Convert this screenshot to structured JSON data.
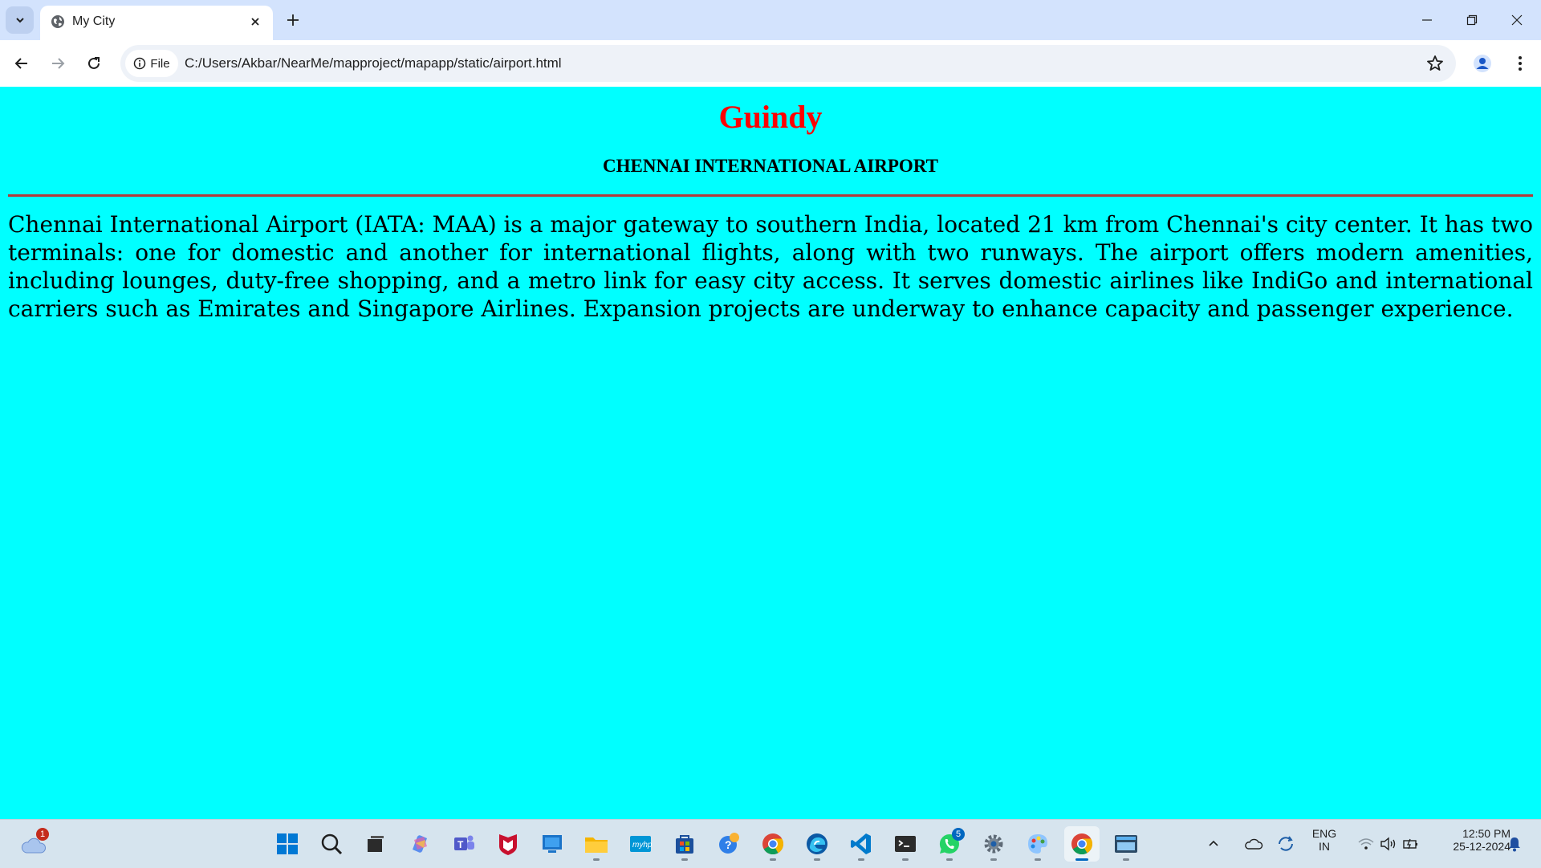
{
  "browser": {
    "tab": {
      "title": "My City"
    },
    "address": {
      "chip": "File",
      "url": "C:/Users/Akbar/NearMe/mapproject/mapapp/static/airport.html"
    }
  },
  "page": {
    "heading": "Guindy",
    "subheading": "CHENNAI INTERNATIONAL AIRPORT",
    "description": "Chennai International Airport (IATA: MAA) is a major gateway to southern India, located 21 km from Chennai's city center. It has two terminals: one for domestic and another for international flights, along with two runways. The airport offers modern amenities, including lounges, duty-free shopping, and a metro link for easy city access. It serves domestic airlines like IndiGo and international carriers such as Emirates and Singapore Airlines. Expansion projects are underway to enhance capacity and passenger experience.",
    "colors": {
      "background": "#00ffff",
      "heading": "#ff0000",
      "rule": "#b23a3a"
    }
  },
  "taskbar": {
    "weather_badge": "1",
    "whatsapp_badge": "5",
    "apps": [
      "start-icon",
      "search-icon",
      "task-view-icon",
      "copilot-icon",
      "teams-icon",
      "mcafee-icon",
      "desktop-app-icon",
      "file-explorer-icon",
      "myhp-icon",
      "store-icon",
      "help-icon",
      "chrome-icon",
      "edge-icon",
      "vscode-icon",
      "terminal-icon",
      "whatsapp-icon",
      "settings-icon",
      "paint-icon",
      "chrome-active-icon",
      "keyboard-app-icon"
    ],
    "language": {
      "line1": "ENG",
      "line2": "IN"
    },
    "clock": {
      "time": "12:50 PM",
      "date": "25-12-2024"
    }
  }
}
